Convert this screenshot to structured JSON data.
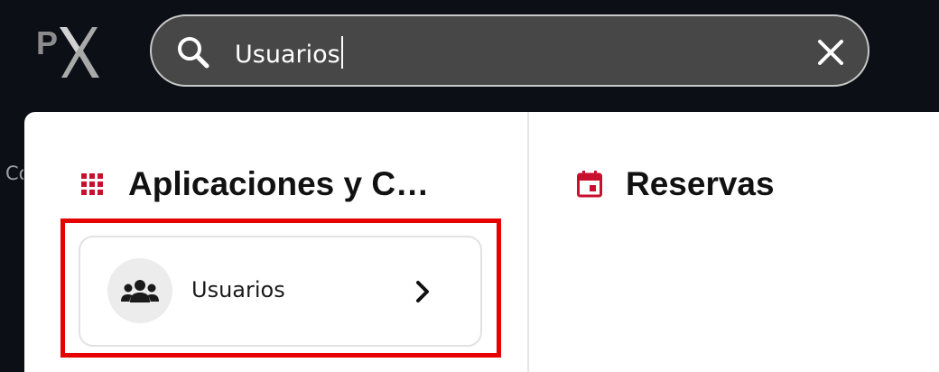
{
  "app": {
    "logo_text": "PX"
  },
  "search": {
    "value": "Usuarios",
    "placeholder": "",
    "search_icon": "search-icon",
    "clear_icon": "close-icon"
  },
  "page": {
    "hint_text": "Co"
  },
  "results": {
    "sections": [
      {
        "title": "Aplicaciones y Configuración",
        "icon": "apps-grid-icon",
        "icon_color": "#c8102e",
        "items": [
          {
            "label": "Usuarios",
            "icon": "group-icon",
            "trailing_icon": "chevron-right-icon",
            "highlighted": true
          }
        ]
      },
      {
        "title": "Reservas",
        "icon": "calendar-icon",
        "icon_color": "#c8102e",
        "items": []
      }
    ]
  },
  "colors": {
    "topbar_bg": "#0c0f16",
    "search_bg": "#474747",
    "accent_red": "#c8102e",
    "highlight_border": "#e60000"
  }
}
